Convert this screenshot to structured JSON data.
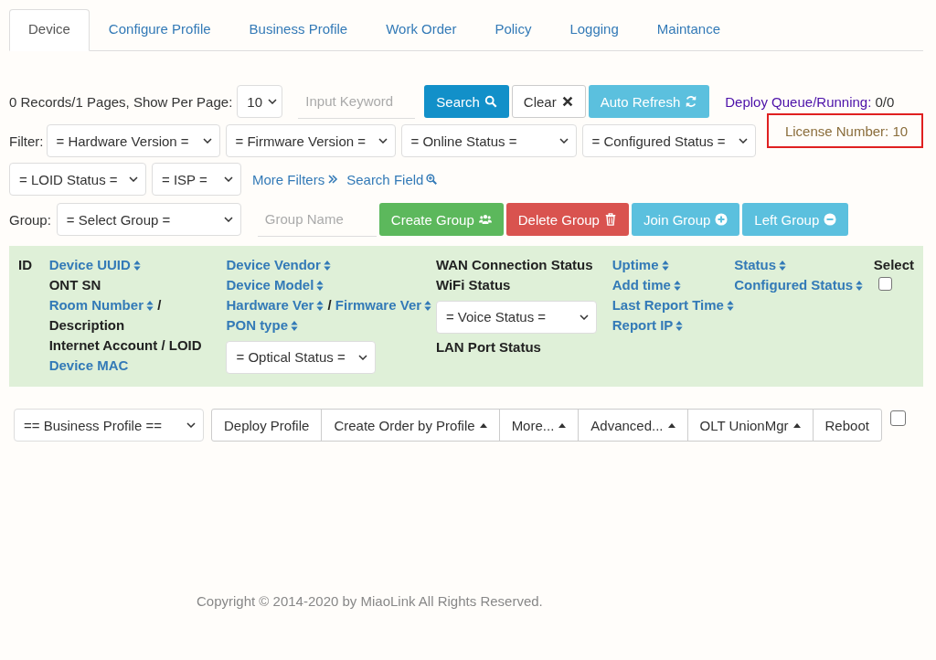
{
  "tabs": [
    {
      "label": "Device",
      "selected": true
    },
    {
      "label": "Configure Profile",
      "selected": false
    },
    {
      "label": "Business Profile",
      "selected": false
    },
    {
      "label": "Work Order",
      "selected": false
    },
    {
      "label": "Policy",
      "selected": false
    },
    {
      "label": "Logging",
      "selected": false
    },
    {
      "label": "Maintance",
      "selected": false
    }
  ],
  "toolbar": {
    "records": "0 Records/1 Pages, Show Per Page:",
    "per_page": "10",
    "keyword": {
      "placeholder": "Input Keyword"
    },
    "buttons": [
      {
        "label": "Search",
        "kind": "search"
      },
      {
        "label": "Clear",
        "kind": "clear"
      },
      {
        "label": "Auto Refresh",
        "kind": "refresh"
      }
    ],
    "deploy_label": "Deploy Queue/Running:",
    "deploy_value": "0/0",
    "license": "License Number: 10"
  },
  "filter": {
    "label": "Filter:",
    "selects": [
      {
        "value": "= Hardware Version ="
      },
      {
        "value": "= Firmware Version ="
      },
      {
        "value": "= Online Status ="
      },
      {
        "value": "= Configured Status ="
      },
      {
        "value": "= LOID Status ="
      },
      {
        "value": "= ISP ="
      }
    ],
    "links": [
      {
        "label": "More Filters",
        "kind": "more"
      },
      {
        "label": "Search Field",
        "kind": "field"
      }
    ]
  },
  "group": {
    "label": "Group:",
    "select": "= Select Group =",
    "name": {
      "placeholder": "Group Name"
    },
    "buttons": [
      {
        "label": "Create Group",
        "kind": "create"
      },
      {
        "label": "Delete Group",
        "kind": "delete"
      },
      {
        "label": "Join Group",
        "kind": "join"
      },
      {
        "label": "Left Group",
        "kind": "leave"
      }
    ]
  },
  "table_header": {
    "columns": [
      [
        [
          {
            "kind": "text",
            "text": "ID"
          }
        ]
      ],
      [
        [
          {
            "kind": "link",
            "text": "Device UUID",
            "sortable": true
          }
        ],
        [
          {
            "kind": "text",
            "text": "ONT SN"
          }
        ],
        [
          {
            "kind": "link",
            "text": "Room Number",
            "sortable": true
          },
          {
            "kind": "text",
            "text": "/"
          }
        ],
        [
          {
            "kind": "text",
            "text": "Description"
          }
        ],
        [
          {
            "kind": "text",
            "text": "Internet Account / LOID"
          }
        ],
        [
          {
            "kind": "link",
            "text": "Device MAC",
            "sortable": false
          }
        ]
      ],
      [
        [
          {
            "kind": "link",
            "text": "Device Vendor",
            "sortable": true
          }
        ],
        [
          {
            "kind": "link",
            "text": "Device Model",
            "sortable": true
          }
        ],
        [
          {
            "kind": "link",
            "text": "Hardware Ver",
            "sortable": true
          },
          {
            "kind": "text",
            "text": "/"
          },
          {
            "kind": "link",
            "text": "Firmware Ver",
            "sortable": true
          }
        ],
        [
          {
            "kind": "link",
            "text": "PON type",
            "sortable": true
          }
        ],
        [
          {
            "kind": "select",
            "text": "= Optical Status ="
          }
        ]
      ],
      [
        [
          {
            "kind": "text",
            "text": "WAN Connection Status"
          }
        ],
        [
          {
            "kind": "text",
            "text": "WiFi Status"
          }
        ],
        [
          {
            "kind": "select",
            "text": "= Voice Status ="
          }
        ],
        [
          {
            "kind": "text",
            "text": "LAN Port Status"
          }
        ]
      ],
      [
        [
          {
            "kind": "link",
            "text": "Uptime",
            "sortable": true
          }
        ],
        [
          {
            "kind": "link",
            "text": "Add time",
            "sortable": true
          }
        ],
        [
          {
            "kind": "link",
            "text": "Last Report Time",
            "sortable": true
          }
        ],
        [
          {
            "kind": "link",
            "text": "Report IP",
            "sortable": true
          }
        ]
      ],
      [
        [
          {
            "kind": "link",
            "text": "Status",
            "sortable": true
          }
        ],
        [
          {
            "kind": "link",
            "text": "Configured Status",
            "sortable": true
          }
        ]
      ],
      [
        [
          {
            "kind": "text",
            "text": "Select"
          }
        ],
        [
          {
            "kind": "checkbox",
            "checked": false
          }
        ]
      ]
    ]
  },
  "actions": {
    "profile_select": "== Business Profile ==",
    "buttons": [
      {
        "label": "Deploy Profile",
        "caret": false
      },
      {
        "label": "Create Order by Profile",
        "caret": true
      },
      {
        "label": "More...",
        "caret": true
      },
      {
        "label": "Advanced...",
        "caret": true
      },
      {
        "label": "OLT UnionMgr",
        "caret": true
      },
      {
        "label": "Reboot",
        "caret": false
      }
    ],
    "select_all": {
      "checked": false
    }
  },
  "footer": "Copyright © 2014-2020 by MiaoLink All Rights Reserved."
}
